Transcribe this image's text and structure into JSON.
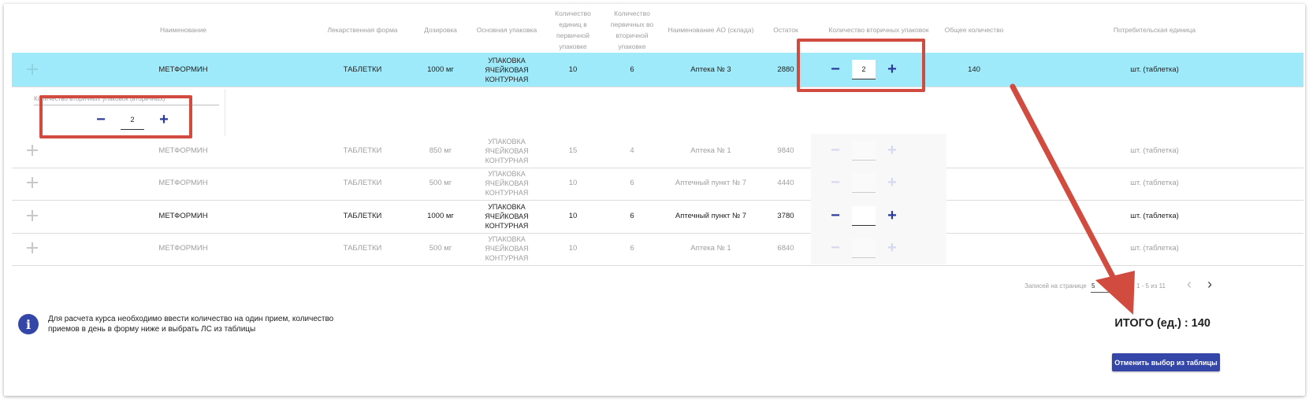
{
  "columns": [
    "Наименование",
    "Лекарственная форма",
    "Дозировка",
    "Основная упаковка",
    "Количество единиц в первичной упаковке",
    "Количество первичных во вторичной упаковке",
    "Наименование АО (склада)",
    "Остаток",
    "Количество вторичных упаковок",
    "Общее количество",
    "Потребительская единица"
  ],
  "rows": [
    {
      "name": "МЕТФОРМИН",
      "form": "ТАБЛЕТКИ",
      "dose": "1000 мг",
      "pack": "УПАКОВКА ЯЧЕЙКОВАЯ КОНТУРНАЯ",
      "units_primary": "10",
      "primary_secondary": "6",
      "pharmacy": "Аптека № 3",
      "stock": "2880",
      "qty": "2",
      "total": "140",
      "unit": "шт. (таблетка)",
      "state": "selected"
    },
    {
      "name": "МЕТФОРМИН",
      "form": "ТАБЛЕТКИ",
      "dose": "850 мг",
      "pack": "УПАКОВКА ЯЧЕЙКОВАЯ КОНТУРНАЯ",
      "units_primary": "15",
      "primary_secondary": "4",
      "pharmacy": "Аптека № 1",
      "stock": "9840",
      "qty": "",
      "total": "",
      "unit": "шт. (таблетка)",
      "state": "disabled"
    },
    {
      "name": "МЕТФОРМИН",
      "form": "ТАБЛЕТКИ",
      "dose": "500 мг",
      "pack": "УПАКОВКА ЯЧЕЙКОВАЯ КОНТУРНАЯ",
      "units_primary": "10",
      "primary_secondary": "6",
      "pharmacy": "Аптечный пункт № 7",
      "stock": "4440",
      "qty": "",
      "total": "",
      "unit": "шт. (таблетка)",
      "state": "disabled"
    },
    {
      "name": "МЕТФОРМИН",
      "form": "ТАБЛЕТКИ",
      "dose": "1000 мг",
      "pack": "УПАКОВКА ЯЧЕЙКОВАЯ КОНТУРНАЯ",
      "units_primary": "10",
      "primary_secondary": "6",
      "pharmacy": "Аптечный пункт № 7",
      "stock": "3780",
      "qty": "",
      "total": "",
      "unit": "шт. (таблетка)",
      "state": "enabled"
    },
    {
      "name": "МЕТФОРМИН",
      "form": "ТАБЛЕТКИ",
      "dose": "500 мг",
      "pack": "УПАКОВКА ЯЧЕЙКОВАЯ КОНТУРНАЯ",
      "units_primary": "10",
      "primary_secondary": "6",
      "pharmacy": "Аптека № 1",
      "stock": "6840",
      "qty": "",
      "total": "",
      "unit": "шт. (таблетка)",
      "state": "disabled"
    }
  ],
  "expanded": {
    "label": "Количество вторичных упаковок (вторичных)",
    "value": "2"
  },
  "pagination": {
    "per_page_label": "Записей на странице",
    "per_page_value": "5",
    "range_text": "1 - 5 из 11",
    "prev_icon": "chevron-left-icon",
    "next_icon": "chevron-right-icon"
  },
  "info": {
    "icon": "info-icon",
    "text": "Для расчета курса необходимо ввести количество на один прием, количество приемов в день в форму ниже и выбрать ЛС из таблицы"
  },
  "total_text": "ИТОГО (ед.) : 140",
  "cancel_button": "Отменить выбор из таблицы",
  "colors": {
    "accent": "#3446a8",
    "selected_row": "#9eeafa",
    "annotation": "#d14b3f"
  }
}
